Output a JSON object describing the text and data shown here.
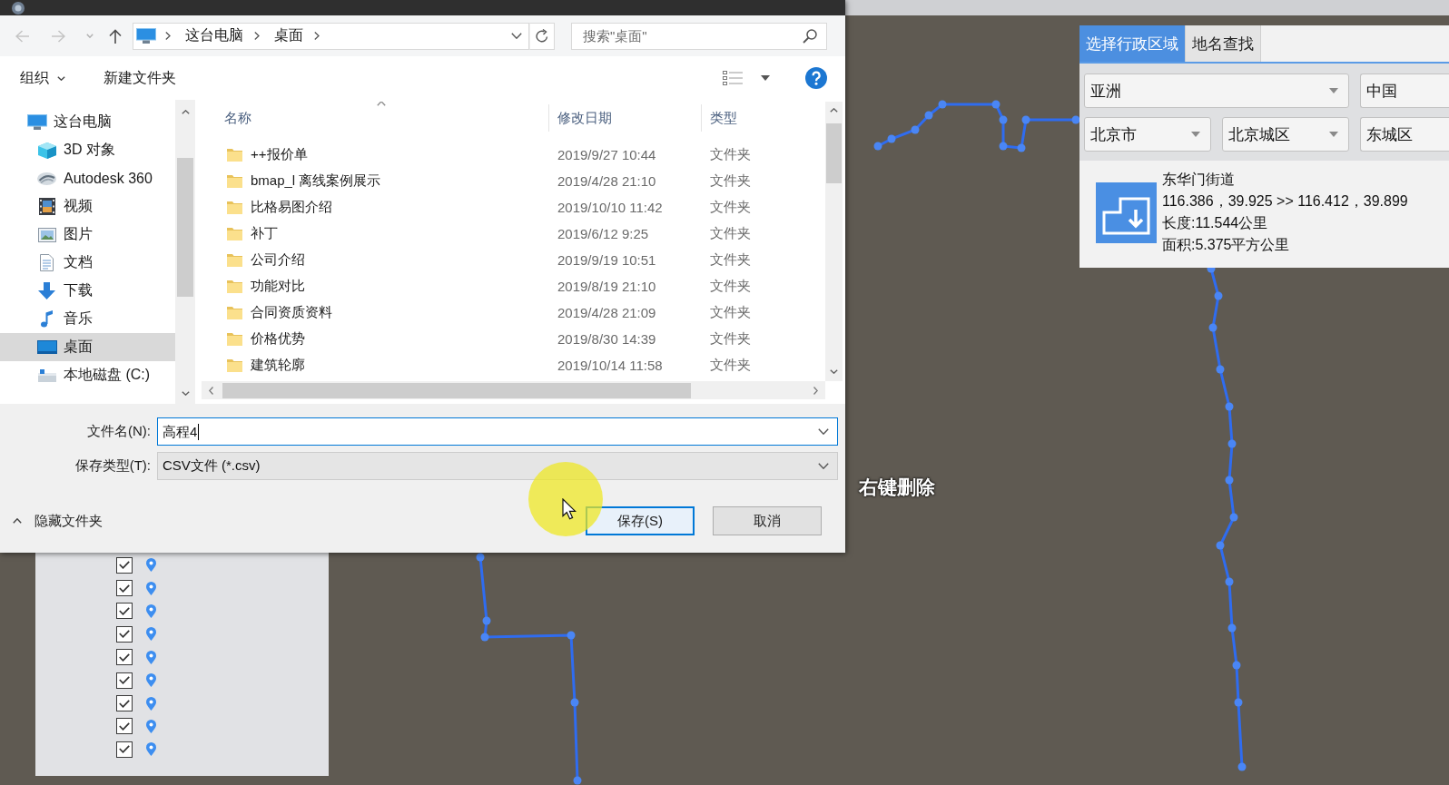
{
  "dialog": {
    "address_bar": {
      "path": [
        "这台电脑",
        "桌面"
      ],
      "search": {
        "placeholder": "搜索\"桌面\""
      }
    },
    "toolbar": {
      "organize": "组织",
      "new_folder": "新建文件夹"
    },
    "nav_tree": [
      {
        "label": "这台电脑",
        "kind": "computer",
        "selected": false,
        "children": [
          {
            "label": "3D 对象",
            "kind": "cube",
            "selected": false
          },
          {
            "label": "Autodesk 360",
            "kind": "cloud",
            "selected": false
          },
          {
            "label": "视频",
            "kind": "video",
            "selected": false
          },
          {
            "label": "图片",
            "kind": "pictures",
            "selected": false
          },
          {
            "label": "文档",
            "kind": "documents",
            "selected": false
          },
          {
            "label": "下载",
            "kind": "downloads",
            "selected": false
          },
          {
            "label": "音乐",
            "kind": "music",
            "selected": false
          },
          {
            "label": "桌面",
            "kind": "desktop",
            "selected": true
          },
          {
            "label": "本地磁盘 (C:)",
            "kind": "drive",
            "selected": false
          }
        ]
      }
    ],
    "file_list": {
      "columns": [
        {
          "label": "名称",
          "sorted": true
        },
        {
          "label": "修改日期",
          "sorted": false
        },
        {
          "label": "类型",
          "sorted": false
        }
      ],
      "rows": [
        {
          "name": "++报价单",
          "modified": "2019/9/27 10:44",
          "type": "文件夹"
        },
        {
          "name": "bmap_l 离线案例展示",
          "modified": "2019/4/28 21:10",
          "type": "文件夹"
        },
        {
          "name": "比格易图介绍",
          "modified": "2019/10/10 11:42",
          "type": "文件夹"
        },
        {
          "name": "补丁",
          "modified": "2019/6/12 9:25",
          "type": "文件夹"
        },
        {
          "name": "公司介绍",
          "modified": "2019/9/19 10:51",
          "type": "文件夹"
        },
        {
          "name": "功能对比",
          "modified": "2019/8/19 21:10",
          "type": "文件夹"
        },
        {
          "name": "合同资质资料",
          "modified": "2019/4/28 21:09",
          "type": "文件夹"
        },
        {
          "name": "价格优势",
          "modified": "2019/8/30 14:39",
          "type": "文件夹"
        },
        {
          "name": "建筑轮廓",
          "modified": "2019/10/14 11:58",
          "type": "文件夹"
        }
      ]
    },
    "file_name": {
      "label": "文件名(N):",
      "value": "高程4"
    },
    "save_type": {
      "label": "保存类型(T):",
      "value": "CSV文件 (*.csv)"
    },
    "hide_folders": "隐藏文件夹",
    "buttons": [
      {
        "label": "保存(S)",
        "default": true
      },
      {
        "label": "取消",
        "default": false
      }
    ]
  },
  "region_panel": {
    "tabs": [
      {
        "label": "选择行政区域",
        "selected": true
      },
      {
        "label": "地名查找",
        "selected": false
      }
    ],
    "selects": [
      [
        "亚洲",
        "中国"
      ],
      [
        "北京市",
        "北京城区",
        "东城区"
      ]
    ],
    "result": {
      "title": "东华门街道",
      "coordinates": "116.386，39.925 >> 116.412，39.899",
      "length": "长度:11.544公里",
      "area": "面积:5.375平方公里"
    }
  },
  "map": {
    "hint": "右键删除"
  },
  "layer_list": [
    {
      "checked": true
    },
    {
      "checked": true
    },
    {
      "checked": true
    },
    {
      "checked": true
    },
    {
      "checked": true
    },
    {
      "checked": true
    },
    {
      "checked": true
    },
    {
      "checked": true
    },
    {
      "checked": true
    }
  ]
}
